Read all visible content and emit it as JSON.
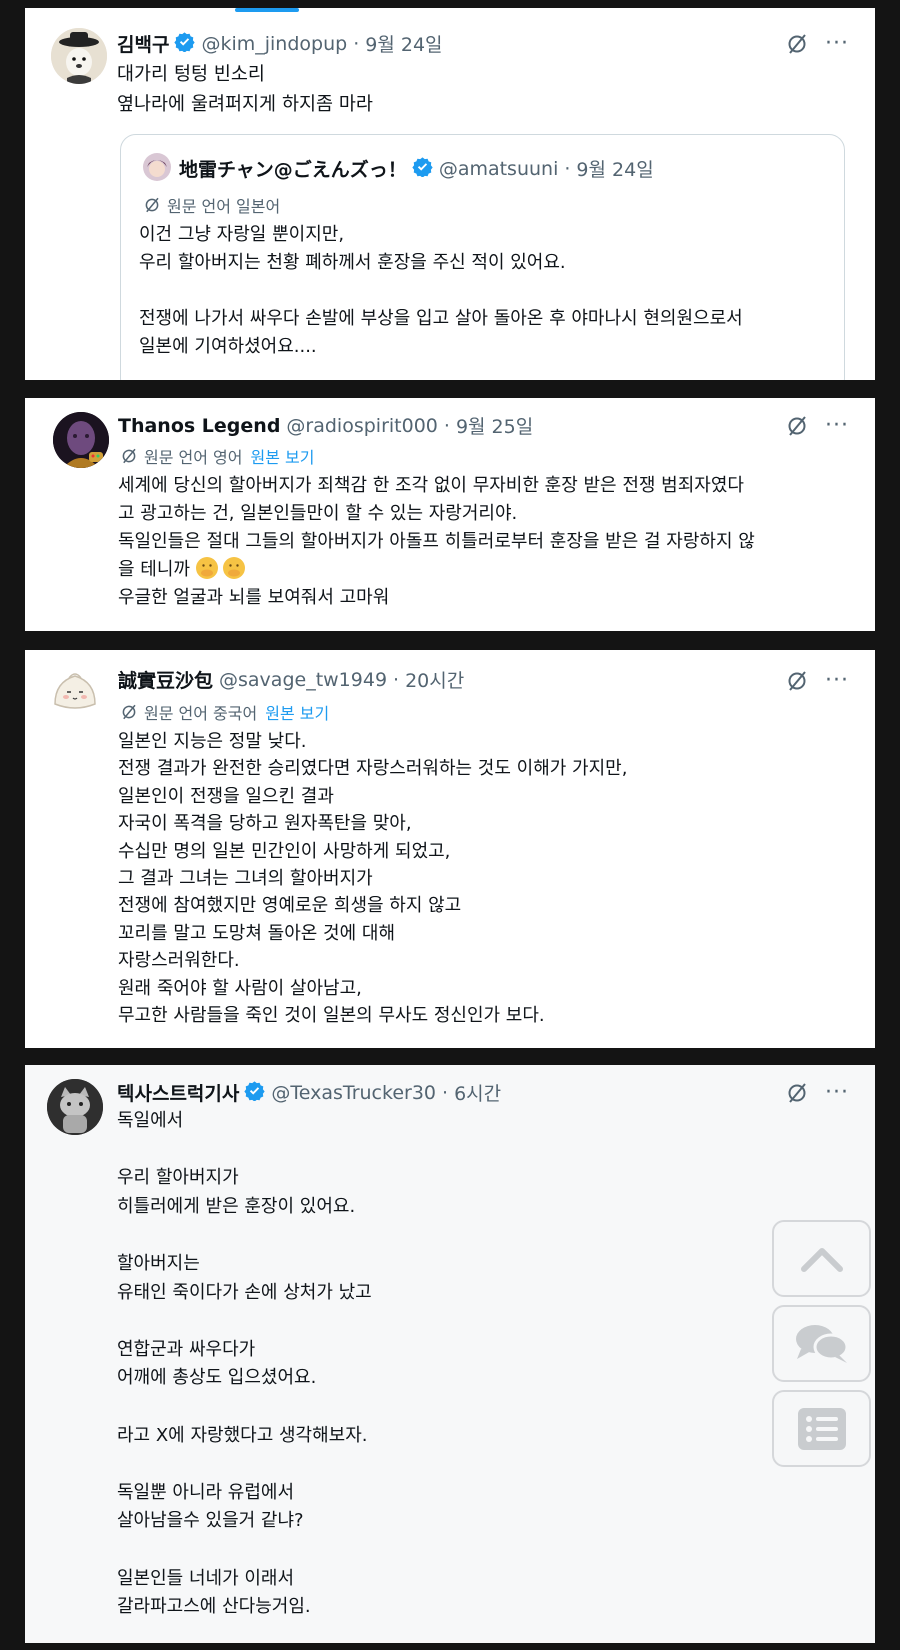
{
  "tweets": [
    {
      "name": "김백구",
      "handle": "@kim_jindopup",
      "time": "9월 24일",
      "verified": true,
      "body": "대가리 텅텅 빈소리\n옆나라에 울려퍼지게 하지좀 마라",
      "quote": {
        "name": "地雷チャン@ごえんズっ！",
        "handle": "@amatsuuni",
        "time": "9월 24일",
        "translate_label": "원문 언어 일본어",
        "body": "이건 그냥 자랑일 뿐이지만,\n우리 할아버지는 천황 폐하께서 훈장을 주신 적이 있어요.\n\n전쟁에 나가서 싸우다 손발에 부상을 입고 살아 돌아온 후 야마나시 현의원으로서\n일본에 기여하셨어요...."
      }
    },
    {
      "name": "Thanos Legend",
      "handle": "@radiospirit000",
      "time": "9월 25일",
      "translate_label": "원문 언어 영어",
      "translate_link": "원본 보기",
      "body_lines": [
        "세계에 당신의 할아버지가 죄책감 한 조각 없이 무자비한 훈장 받은 전쟁 범죄자였다",
        "고 광고하는 건, 일본인들만이 할 수 있는 자랑거리야.",
        "독일인들은 절대 그들의 할아버지가 아돌프 히틀러로부터 훈장을 받은 걸 자랑하지 않",
        "을 테니까",
        "우글한 얼굴과 뇌를 보여줘서 고마워"
      ],
      "emoji": "face-with-hand-over-mouth"
    },
    {
      "name": "誠實豆沙包",
      "handle": "@savage_tw1949",
      "time": "20시간",
      "translate_label": "원문 언어 중국어",
      "translate_link": "원본 보기",
      "body": "일본인 지능은 정말 낮다.\n전쟁 결과가 완전한 승리였다면 자랑스러워하는 것도 이해가 가지만,\n일본인이 전쟁을 일으킨 결과\n자국이 폭격을 당하고 원자폭탄을 맞아,\n수십만 명의 일본 민간인이 사망하게 되었고,\n그 결과 그녀는 그녀의 할아버지가\n전쟁에 참여했지만 영예로운 희생을 하지 않고\n꼬리를 말고 도망쳐 돌아온 것에 대해\n자랑스러워한다.\n원래 죽어야 할 사람이 살아남고,\n무고한 사람들을 죽인 것이 일본의 무사도 정신인가 보다."
    },
    {
      "name": "텍사스트럭기사",
      "handle": "@TexasTrucker30",
      "time": "6시간",
      "verified": true,
      "body": "독일에서\n\n우리 할아버지가\n히틀러에게 받은 훈장이 있어요.\n\n할아버지는\n유태인 죽이다가 손에 상처가 났고\n\n연합군과 싸우다가\n어깨에 총상도 입으셨어요.\n\n라고 X에 자랑했다고 생각해보자.\n\n독일뿐 아니라 유럽에서\n살아남을수 있을거 같냐?\n\n일본인들 너네가 이래서\n갈라파고스에 산다능거임."
    }
  ],
  "separator": "·",
  "more_label": "···",
  "side_buttons": [
    "scroll-top",
    "comments",
    "list"
  ],
  "colors": {
    "accent": "#1d9bf0",
    "text": "#0f1419",
    "muted": "#536471",
    "background": "#141414"
  }
}
